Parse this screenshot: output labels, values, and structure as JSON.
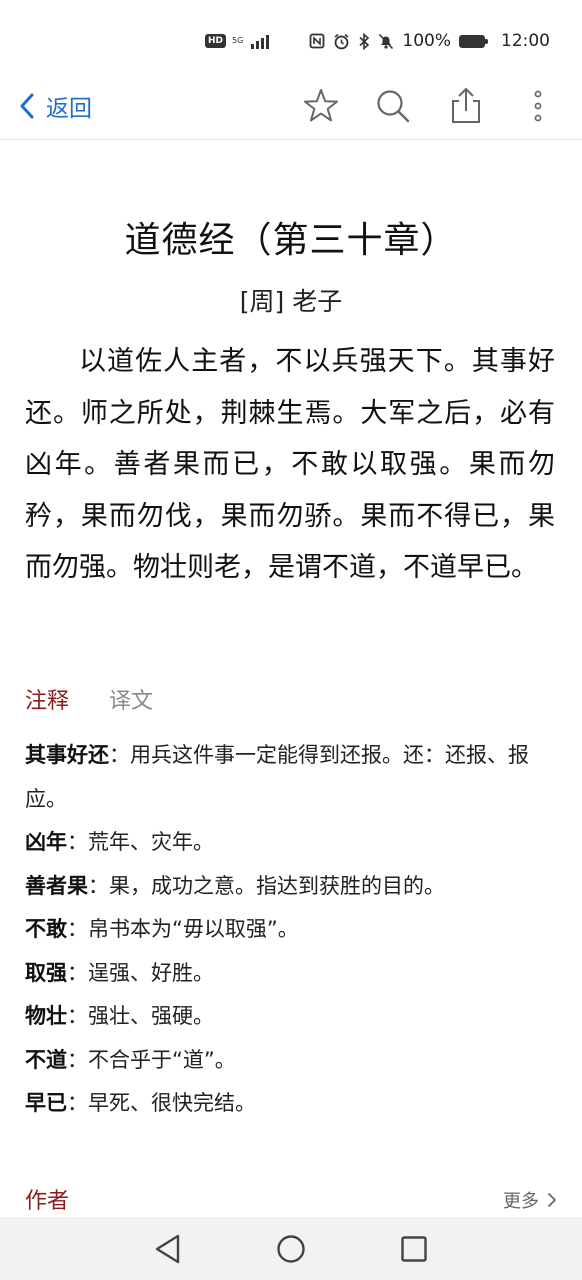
{
  "status_bar": {
    "network": "5G",
    "battery_text": "100%",
    "time": "12:00",
    "icons": [
      "hd-icon",
      "signal-icon",
      "nfc-icon",
      "alarm-icon",
      "bluetooth-icon",
      "mute-icon",
      "battery-icon"
    ]
  },
  "toolbar": {
    "back_label": "返回",
    "icons": [
      "star-icon",
      "search-icon",
      "share-icon",
      "more-vertical-icon"
    ]
  },
  "poem": {
    "title": "道德经（第三十章）",
    "author": "[周] 老子",
    "body": "以道佐人主者，不以兵强天下。其事好还。师之所处，荆棘生焉。大军之后，必有凶年。善者果而已，不敢以取强。果而勿矜，果而勿伐，果而勿骄。果而不得已，果而勿强。物壮则老，是谓不道，不道早已。"
  },
  "tabs": [
    {
      "label": "注释",
      "active": true
    },
    {
      "label": "译文",
      "active": false
    }
  ],
  "notes": [
    {
      "term": "其事好还",
      "text": "：用兵这件事一定能得到还报。还：还报、报应。"
    },
    {
      "term": "凶年",
      "text": "：荒年、灾年。"
    },
    {
      "term": "善者果",
      "text": "：果，成功之意。指达到获胜的目的。"
    },
    {
      "term": "不敢",
      "text": "：帛书本为“毋以取强”。"
    },
    {
      "term": "取强",
      "text": "：逞强、好胜。"
    },
    {
      "term": "物壮",
      "text": "：强壮、强硬。"
    },
    {
      "term": "不道",
      "text": "：不合乎于“道”。"
    },
    {
      "term": "早已",
      "text": "：早死、很快完结。"
    }
  ],
  "author_section": {
    "label": "作者",
    "more_label": "更多"
  },
  "colors": {
    "accent_blue": "#1f6fc9",
    "accent_red": "#8b1c1c",
    "muted": "#8a8a8a"
  },
  "nav_bar": {
    "icons": [
      "back-triangle-icon",
      "home-circle-icon",
      "recents-square-icon"
    ]
  }
}
